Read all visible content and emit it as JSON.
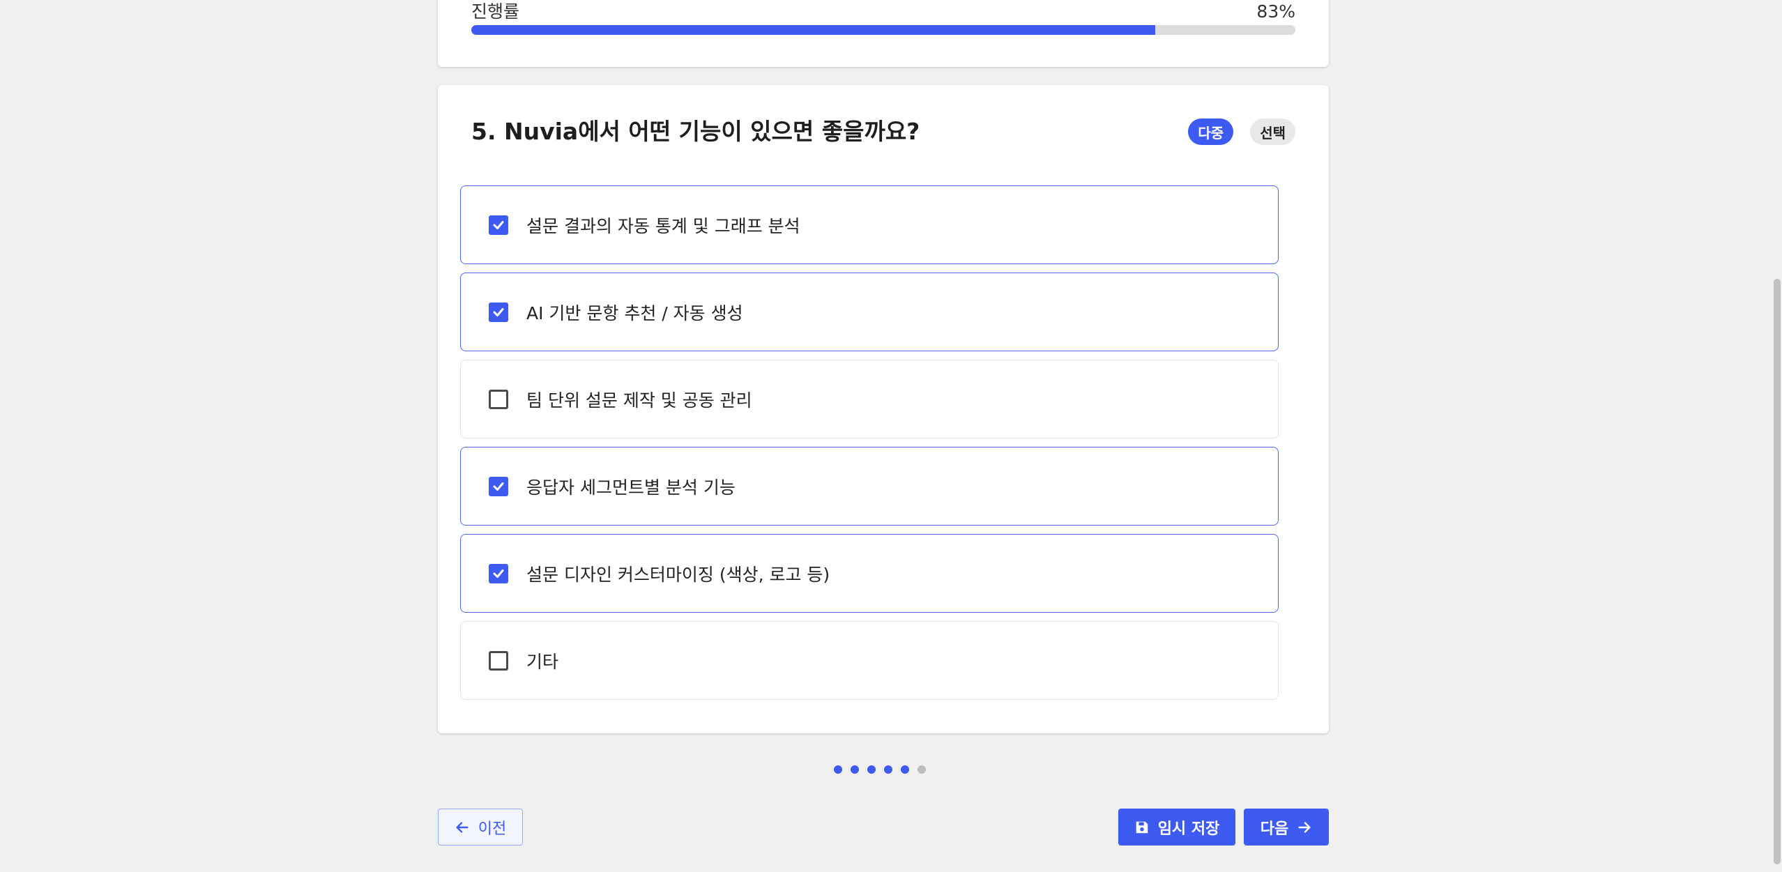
{
  "progress": {
    "label": "진행률",
    "value_text": "83%",
    "fraction": 0.83
  },
  "question": {
    "title": "5. Nuvia에서 어떤 기능이 있으면 좋을까요?",
    "badges": [
      "다중",
      "선택"
    ],
    "options": [
      {
        "label": "설문 결과의 자동 통계 및 그래프 분석",
        "checked": true
      },
      {
        "label": "AI 기반 문항 추천 / 자동 생성",
        "checked": true
      },
      {
        "label": "팀 단위 설문 제작 및 공동 관리",
        "checked": false
      },
      {
        "label": "응답자 세그먼트별 분석 기능",
        "checked": true
      },
      {
        "label": "설문 디자인 커스터마이징 (색상, 로고 등)",
        "checked": true
      },
      {
        "label": "기타",
        "checked": false
      }
    ]
  },
  "pagination": {
    "total": 6,
    "completed": 5
  },
  "nav": {
    "prev_label": "이전",
    "save_label": "임시 저장",
    "next_label": "다음"
  },
  "colors": {
    "accent": "#3d5af1"
  },
  "icons": {
    "prev": "arrow-left-icon",
    "save": "floppy-disk-icon",
    "next": "arrow-right-icon",
    "check": "check-icon"
  }
}
